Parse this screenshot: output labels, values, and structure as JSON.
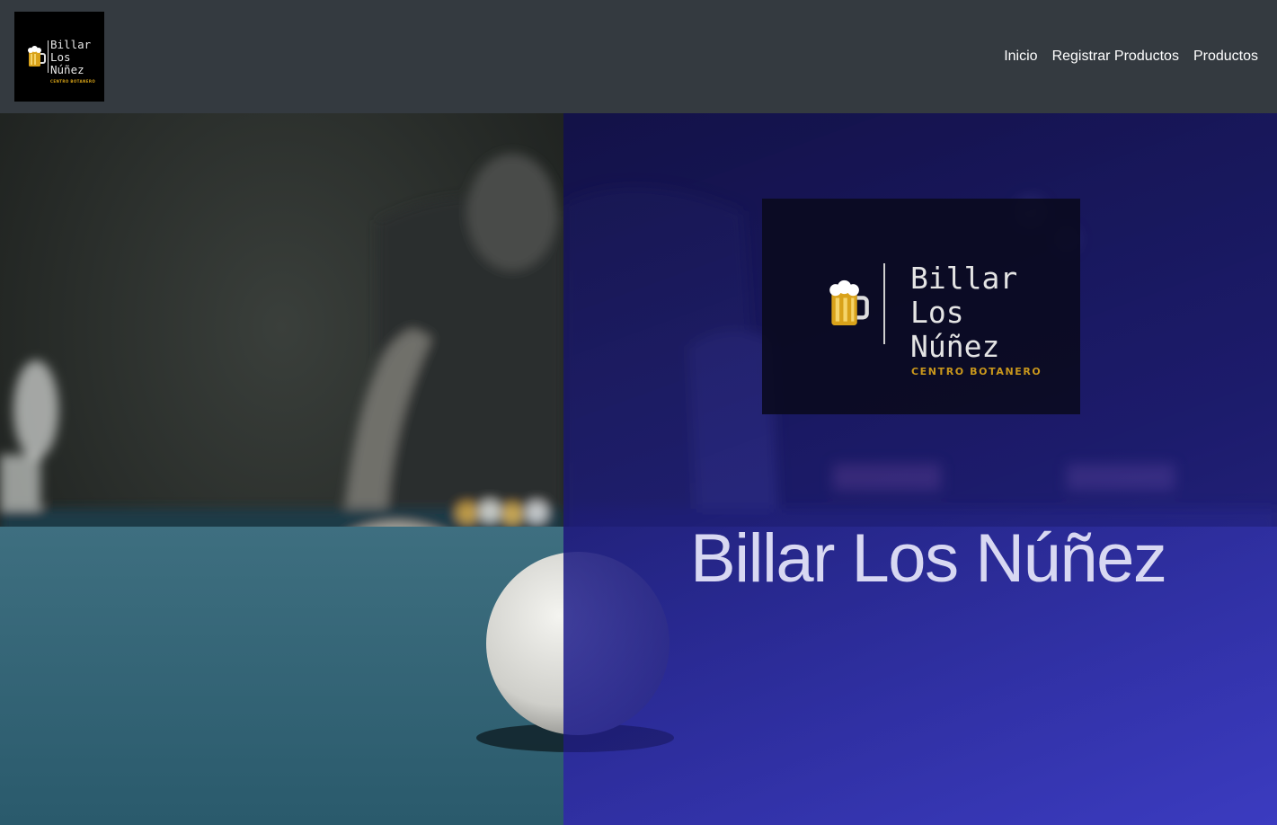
{
  "brand": {
    "name_line1": "Billar",
    "name_line2": "Los",
    "name_line3": "Núñez",
    "tagline": "CENTRO BOTANERO"
  },
  "nav": {
    "links": [
      {
        "label": "Inicio",
        "icon": ""
      },
      {
        "label": "Registrar Productos",
        "icon": ""
      },
      {
        "label": "Productos",
        "icon": ""
      }
    ]
  },
  "hero": {
    "title": "Billar Los Núñez",
    "logo_icon": "beer-mug-icon"
  },
  "colors": {
    "navbar_bg": "#343a40",
    "overlay_blue": "#2a2a9a",
    "tagline_gold": "#c9971c"
  }
}
